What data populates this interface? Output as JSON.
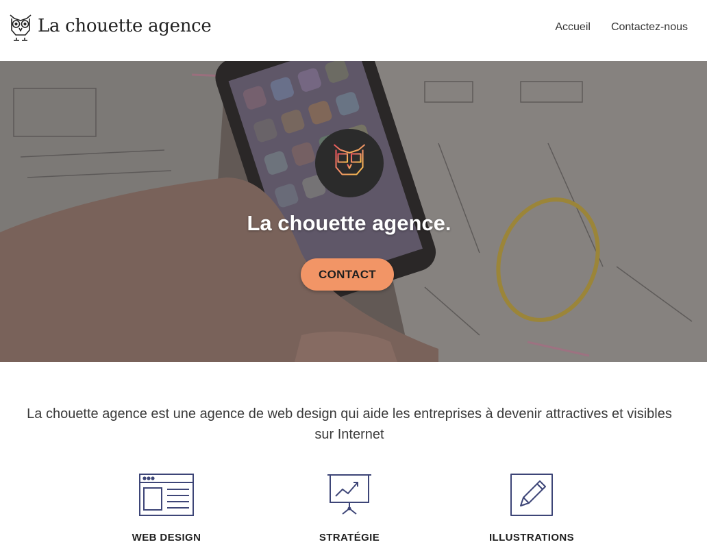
{
  "header": {
    "brand": "La chouette agence",
    "nav": [
      {
        "label": "Accueil"
      },
      {
        "label": "Contactez-nous"
      }
    ]
  },
  "hero": {
    "title": "La chouette agence.",
    "cta_label": "CONTACT",
    "colors": {
      "cta": "#f29566",
      "badge": "#2b2b2b"
    }
  },
  "intro": {
    "text": "La chouette agence est une agence de web design qui aide les entreprises à devenir attractives et visibles sur Internet"
  },
  "services": [
    {
      "label": "WEB DESIGN",
      "icon": "web-layout-icon"
    },
    {
      "label": "STRATÉGIE",
      "icon": "presentation-chart-icon"
    },
    {
      "label": "ILLUSTRATIONS",
      "icon": "pencil-icon"
    }
  ],
  "colors": {
    "accent": "#f29566",
    "icon_stroke": "#3d4577"
  }
}
